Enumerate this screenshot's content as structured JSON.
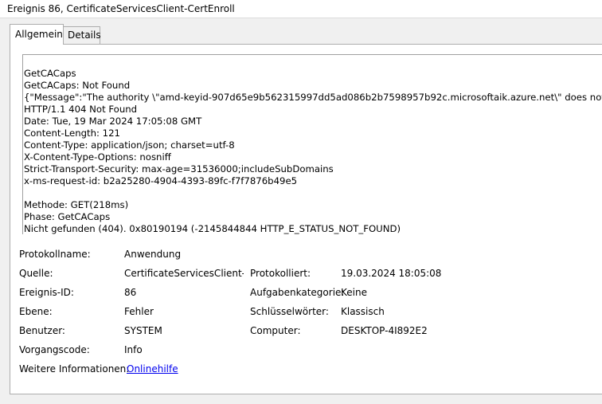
{
  "window": {
    "title": "Ereignis 86, CertificateServicesClient-CertEnroll"
  },
  "tabs": [
    {
      "label": "Allgemein",
      "active": true
    },
    {
      "label": "Details",
      "active": false
    }
  ],
  "message": {
    "lines": [
      "GetCACaps",
      "GetCACaps: Not Found",
      "{\"Message\":\"The authority \\\"amd-keyid-907d65e9b562315997dd5ad086b2b7598957b92c.microsoftaik.azure.net\\\" does not exist.\"}",
      "HTTP/1.1 404 Not Found",
      "Date: Tue, 19 Mar 2024 17:05:08 GMT",
      "Content-Length: 121",
      "Content-Type: application/json; charset=utf-8",
      "X-Content-Type-Options: nosniff",
      "Strict-Transport-Security: max-age=31536000;includeSubDomains",
      "x-ms-request-id: b2a25280-4904-4393-89fc-f7f7876b49e5",
      "",
      "Methode: GET(218ms)",
      "Phase: GetCACaps",
      "Nicht gefunden (404). 0x80190194 (-2145844844 HTTP_E_STATUS_NOT_FOUND)"
    ]
  },
  "properties": {
    "protokollname": {
      "label": "Protokollname:",
      "value": "Anwendung"
    },
    "quelle": {
      "label": "Quelle:",
      "value": "CertificateServicesClient-CertEnroll"
    },
    "protokolliert": {
      "label": "Protokolliert:",
      "value": "19.03.2024 18:05:08"
    },
    "ereignis_id": {
      "label": "Ereignis-ID:",
      "value": "86"
    },
    "aufgabenkategorie": {
      "label": "Aufgabenkategorie:",
      "value": "Keine"
    },
    "ebene": {
      "label": "Ebene:",
      "value": "Fehler"
    },
    "schluesselwoerter": {
      "label": "Schlüsselwörter:",
      "value": "Klassisch"
    },
    "benutzer": {
      "label": "Benutzer:",
      "value": "SYSTEM"
    },
    "computer": {
      "label": "Computer:",
      "value": "DESKTOP-4I892E2"
    },
    "vorgangscode": {
      "label": "Vorgangscode:",
      "value": "Info"
    },
    "weitere_informationen": {
      "label": "Weitere Informationen:",
      "link": "Onlinehilfe"
    }
  },
  "colors": {
    "link": "#0000ee",
    "tab_border": "#adadad",
    "client_bg": "#f0f0f0"
  }
}
